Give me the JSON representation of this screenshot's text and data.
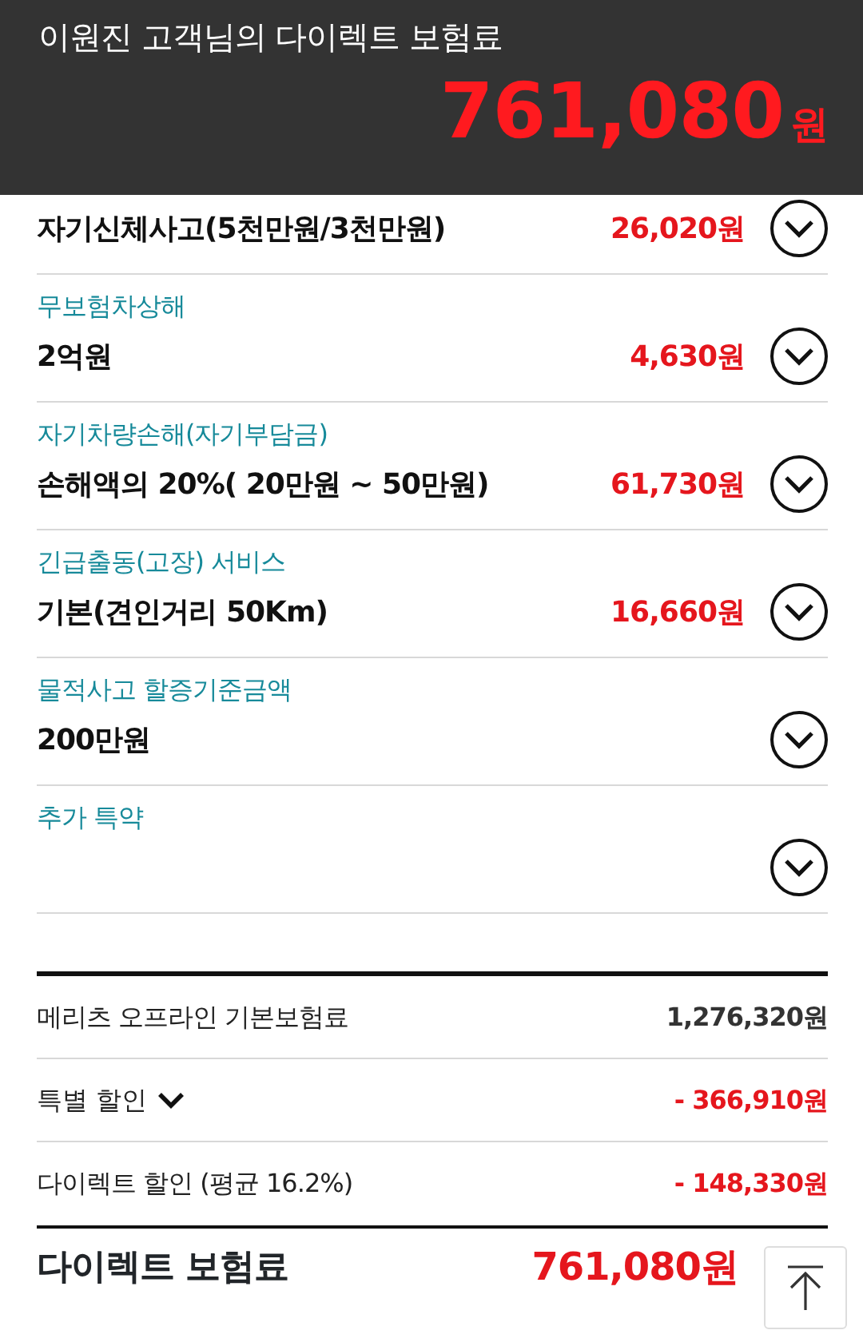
{
  "header": {
    "title": "이원진  고객님의 다이렉트 보험료",
    "amount": "761,080",
    "unit": "원"
  },
  "coverages": [
    {
      "value": "자기신체사고(5천만원/3천만원)",
      "price": "26,020원"
    },
    {
      "label": "무보험차상해",
      "value": "2억원",
      "price": "4,630원"
    },
    {
      "label": "자기차량손해(자기부담금)",
      "value": "손해액의 20%( 20만원 ~ 50만원)",
      "price": "61,730원"
    },
    {
      "label": "긴급출동(고장) 서비스",
      "value": "기본(견인거리 50Km)",
      "price": "16,660원"
    },
    {
      "label": "물적사고 할증기준금액",
      "value": "200만원"
    },
    {
      "label": "추가 특약"
    }
  ],
  "summary": [
    {
      "kind": "base",
      "label": "메리츠 오프라인 기본보험료",
      "amount": "1,276,320원"
    },
    {
      "kind": "toggle",
      "label": "특별 할인",
      "amount": "- 366,910원"
    },
    {
      "kind": "discount",
      "label": "다이렉트 할인 (평균 16.2%)",
      "amount": "- 148,330원"
    }
  ],
  "total": {
    "label": "다이렉트 보험료",
    "amount": "761,080원"
  }
}
